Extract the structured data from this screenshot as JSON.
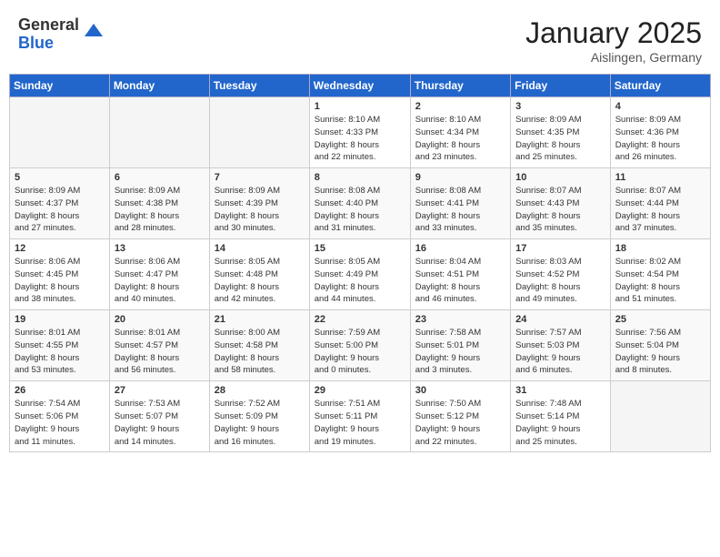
{
  "header": {
    "logo_general": "General",
    "logo_blue": "Blue",
    "month_title": "January 2025",
    "location": "Aislingen, Germany"
  },
  "weekdays": [
    "Sunday",
    "Monday",
    "Tuesday",
    "Wednesday",
    "Thursday",
    "Friday",
    "Saturday"
  ],
  "weeks": [
    [
      {
        "day": "",
        "info": ""
      },
      {
        "day": "",
        "info": ""
      },
      {
        "day": "",
        "info": ""
      },
      {
        "day": "1",
        "info": "Sunrise: 8:10 AM\nSunset: 4:33 PM\nDaylight: 8 hours\nand 22 minutes."
      },
      {
        "day": "2",
        "info": "Sunrise: 8:10 AM\nSunset: 4:34 PM\nDaylight: 8 hours\nand 23 minutes."
      },
      {
        "day": "3",
        "info": "Sunrise: 8:09 AM\nSunset: 4:35 PM\nDaylight: 8 hours\nand 25 minutes."
      },
      {
        "day": "4",
        "info": "Sunrise: 8:09 AM\nSunset: 4:36 PM\nDaylight: 8 hours\nand 26 minutes."
      }
    ],
    [
      {
        "day": "5",
        "info": "Sunrise: 8:09 AM\nSunset: 4:37 PM\nDaylight: 8 hours\nand 27 minutes."
      },
      {
        "day": "6",
        "info": "Sunrise: 8:09 AM\nSunset: 4:38 PM\nDaylight: 8 hours\nand 28 minutes."
      },
      {
        "day": "7",
        "info": "Sunrise: 8:09 AM\nSunset: 4:39 PM\nDaylight: 8 hours\nand 30 minutes."
      },
      {
        "day": "8",
        "info": "Sunrise: 8:08 AM\nSunset: 4:40 PM\nDaylight: 8 hours\nand 31 minutes."
      },
      {
        "day": "9",
        "info": "Sunrise: 8:08 AM\nSunset: 4:41 PM\nDaylight: 8 hours\nand 33 minutes."
      },
      {
        "day": "10",
        "info": "Sunrise: 8:07 AM\nSunset: 4:43 PM\nDaylight: 8 hours\nand 35 minutes."
      },
      {
        "day": "11",
        "info": "Sunrise: 8:07 AM\nSunset: 4:44 PM\nDaylight: 8 hours\nand 37 minutes."
      }
    ],
    [
      {
        "day": "12",
        "info": "Sunrise: 8:06 AM\nSunset: 4:45 PM\nDaylight: 8 hours\nand 38 minutes."
      },
      {
        "day": "13",
        "info": "Sunrise: 8:06 AM\nSunset: 4:47 PM\nDaylight: 8 hours\nand 40 minutes."
      },
      {
        "day": "14",
        "info": "Sunrise: 8:05 AM\nSunset: 4:48 PM\nDaylight: 8 hours\nand 42 minutes."
      },
      {
        "day": "15",
        "info": "Sunrise: 8:05 AM\nSunset: 4:49 PM\nDaylight: 8 hours\nand 44 minutes."
      },
      {
        "day": "16",
        "info": "Sunrise: 8:04 AM\nSunset: 4:51 PM\nDaylight: 8 hours\nand 46 minutes."
      },
      {
        "day": "17",
        "info": "Sunrise: 8:03 AM\nSunset: 4:52 PM\nDaylight: 8 hours\nand 49 minutes."
      },
      {
        "day": "18",
        "info": "Sunrise: 8:02 AM\nSunset: 4:54 PM\nDaylight: 8 hours\nand 51 minutes."
      }
    ],
    [
      {
        "day": "19",
        "info": "Sunrise: 8:01 AM\nSunset: 4:55 PM\nDaylight: 8 hours\nand 53 minutes."
      },
      {
        "day": "20",
        "info": "Sunrise: 8:01 AM\nSunset: 4:57 PM\nDaylight: 8 hours\nand 56 minutes."
      },
      {
        "day": "21",
        "info": "Sunrise: 8:00 AM\nSunset: 4:58 PM\nDaylight: 8 hours\nand 58 minutes."
      },
      {
        "day": "22",
        "info": "Sunrise: 7:59 AM\nSunset: 5:00 PM\nDaylight: 9 hours\nand 0 minutes."
      },
      {
        "day": "23",
        "info": "Sunrise: 7:58 AM\nSunset: 5:01 PM\nDaylight: 9 hours\nand 3 minutes."
      },
      {
        "day": "24",
        "info": "Sunrise: 7:57 AM\nSunset: 5:03 PM\nDaylight: 9 hours\nand 6 minutes."
      },
      {
        "day": "25",
        "info": "Sunrise: 7:56 AM\nSunset: 5:04 PM\nDaylight: 9 hours\nand 8 minutes."
      }
    ],
    [
      {
        "day": "26",
        "info": "Sunrise: 7:54 AM\nSunset: 5:06 PM\nDaylight: 9 hours\nand 11 minutes."
      },
      {
        "day": "27",
        "info": "Sunrise: 7:53 AM\nSunset: 5:07 PM\nDaylight: 9 hours\nand 14 minutes."
      },
      {
        "day": "28",
        "info": "Sunrise: 7:52 AM\nSunset: 5:09 PM\nDaylight: 9 hours\nand 16 minutes."
      },
      {
        "day": "29",
        "info": "Sunrise: 7:51 AM\nSunset: 5:11 PM\nDaylight: 9 hours\nand 19 minutes."
      },
      {
        "day": "30",
        "info": "Sunrise: 7:50 AM\nSunset: 5:12 PM\nDaylight: 9 hours\nand 22 minutes."
      },
      {
        "day": "31",
        "info": "Sunrise: 7:48 AM\nSunset: 5:14 PM\nDaylight: 9 hours\nand 25 minutes."
      },
      {
        "day": "",
        "info": ""
      }
    ]
  ]
}
